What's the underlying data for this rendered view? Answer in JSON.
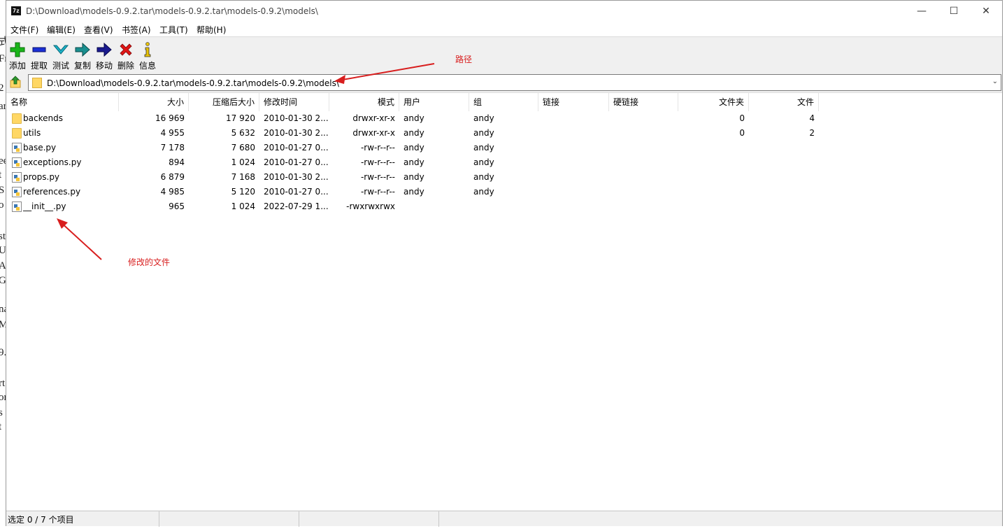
{
  "window": {
    "title": "D:\\Download\\models-0.9.2.tar\\models-0.9.2.tar\\models-0.9.2\\models\\",
    "app_icon_text": "7z",
    "minimize": "—",
    "maximize": "☐",
    "close": "✕"
  },
  "menu": [
    "文件(F)",
    "编辑(E)",
    "查看(V)",
    "书签(A)",
    "工具(T)",
    "帮助(H)"
  ],
  "toolbar": [
    {
      "label": "添加",
      "icon": "plus-icon",
      "color": "#19b519"
    },
    {
      "label": "提取",
      "icon": "minus-icon",
      "color": "#1a2fd6"
    },
    {
      "label": "测试",
      "icon": "check-down-icon",
      "color": "#1bb3c9"
    },
    {
      "label": "复制",
      "icon": "copy-arrow-icon",
      "color": "#1a8f8f"
    },
    {
      "label": "移动",
      "icon": "move-arrow-icon",
      "color": "#1a1a8f"
    },
    {
      "label": "删除",
      "icon": "delete-x-icon",
      "color": "#e01515"
    },
    {
      "label": "信息",
      "icon": "info-icon",
      "color": "#c9a000"
    }
  ],
  "address": {
    "path": "D:\\Download\\models-0.9.2.tar\\models-0.9.2.tar\\models-0.9.2\\models\\"
  },
  "columns": [
    "名称",
    "大小",
    "压缩后大小",
    "修改时间",
    "模式",
    "用户",
    "组",
    "链接",
    "硬链接",
    "文件夹",
    "文件"
  ],
  "rows": [
    {
      "type": "folder",
      "name": "backends",
      "size": "16 969",
      "packed": "17 920",
      "modified": "2010-01-30 2...",
      "mode": "drwxr-xr-x",
      "user": "andy",
      "group": "andy",
      "link": "",
      "hardlink": "",
      "folders": "0",
      "files": "4"
    },
    {
      "type": "folder",
      "name": "utils",
      "size": "4 955",
      "packed": "5 632",
      "modified": "2010-01-30 2...",
      "mode": "drwxr-xr-x",
      "user": "andy",
      "group": "andy",
      "link": "",
      "hardlink": "",
      "folders": "0",
      "files": "2"
    },
    {
      "type": "py",
      "name": "base.py",
      "size": "7 178",
      "packed": "7 680",
      "modified": "2010-01-27 0...",
      "mode": "-rw-r--r--",
      "user": "andy",
      "group": "andy",
      "link": "",
      "hardlink": "",
      "folders": "",
      "files": ""
    },
    {
      "type": "py",
      "name": "exceptions.py",
      "size": "894",
      "packed": "1 024",
      "modified": "2010-01-27 0...",
      "mode": "-rw-r--r--",
      "user": "andy",
      "group": "andy",
      "link": "",
      "hardlink": "",
      "folders": "",
      "files": ""
    },
    {
      "type": "py",
      "name": "props.py",
      "size": "6 879",
      "packed": "7 168",
      "modified": "2010-01-30 2...",
      "mode": "-rw-r--r--",
      "user": "andy",
      "group": "andy",
      "link": "",
      "hardlink": "",
      "folders": "",
      "files": ""
    },
    {
      "type": "py",
      "name": "references.py",
      "size": "4 985",
      "packed": "5 120",
      "modified": "2010-01-27 0...",
      "mode": "-rw-r--r--",
      "user": "andy",
      "group": "andy",
      "link": "",
      "hardlink": "",
      "folders": "",
      "files": ""
    },
    {
      "type": "py",
      "name": "__init__.py",
      "size": "965",
      "packed": "1 024",
      "modified": "2022-07-29 1...",
      "mode": "-rwxrwxrwx",
      "user": "",
      "group": "",
      "link": "",
      "hardlink": "",
      "folders": "",
      "files": ""
    }
  ],
  "status": {
    "selection": "选定 0 / 7 个项目"
  },
  "annotations": {
    "path_label": "路径",
    "modified_label": "修改的文件",
    "color": "#d81e1e"
  },
  "background_doc_fragments": [
    "式",
    "Fr",
    "2",
    "ar",
    "ee",
    "t",
    "S",
    "o",
    "st",
    "U",
    "A",
    "G",
    "na",
    "M",
    "9.",
    "rt",
    "or",
    "s",
    "t"
  ]
}
